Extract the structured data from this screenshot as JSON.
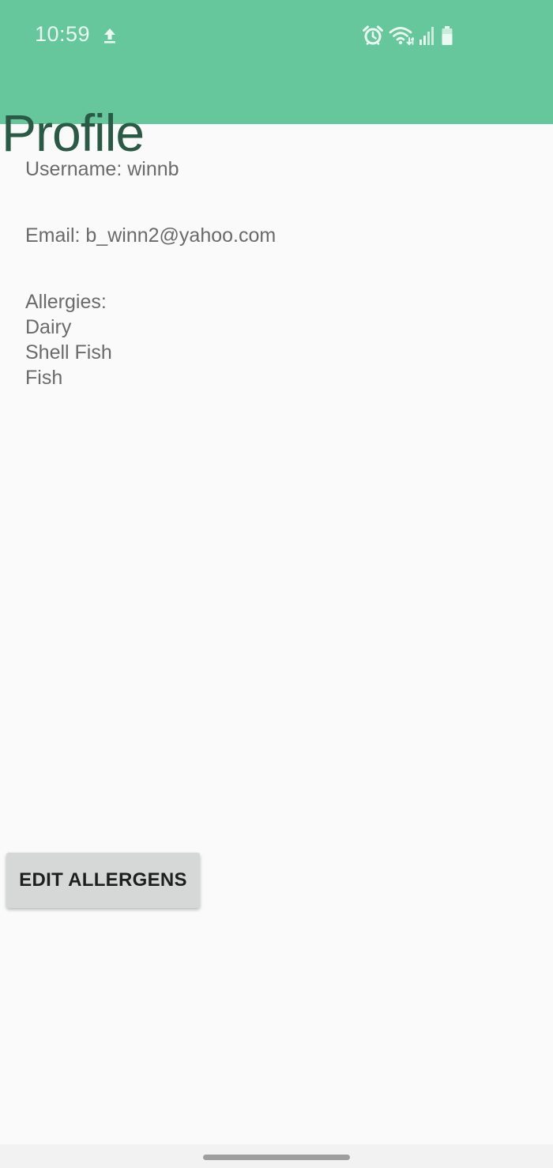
{
  "status_bar": {
    "time": "10:59",
    "icons": [
      "upload-icon",
      "alarm-icon",
      "wifi-icon",
      "signal-icon",
      "battery-icon"
    ]
  },
  "header": {
    "title": "Profile",
    "color": "#66c79d"
  },
  "profile": {
    "username_line": "Username: winnb",
    "email_line": "Email: b_winn2@yahoo.com",
    "allergies_label": "Allergies:",
    "allergies": [
      "Dairy",
      "Shell Fish",
      "Fish"
    ]
  },
  "actions": {
    "edit_allergens_label": "EDIT ALLERGENS"
  }
}
